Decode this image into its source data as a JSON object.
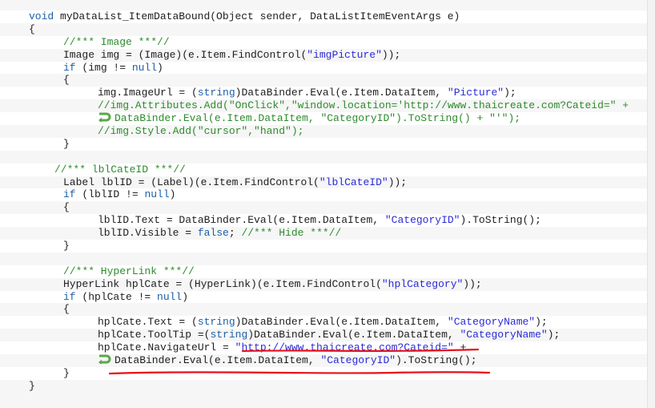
{
  "code_lines": [
    [
      [
        "kw",
        "void"
      ],
      [
        "tx",
        " myDataList_ItemDataBound(Object sender, DataListItemEventArgs e)"
      ]
    ],
    [
      [
        "tx",
        "{"
      ]
    ],
    [
      [
        "cm",
        "//*** Image ***//"
      ]
    ],
    [
      [
        "tx",
        "Image img = (Image)(e.Item.FindControl("
      ],
      [
        "str",
        "\"imgPicture\""
      ],
      [
        "tx",
        "));"
      ]
    ],
    [
      [
        "kw",
        "if"
      ],
      [
        "tx",
        " (img != "
      ],
      [
        "kw",
        "null"
      ],
      [
        "tx",
        ")"
      ]
    ],
    [
      [
        "tx",
        "{"
      ]
    ],
    [
      [
        "tx",
        "img.ImageUrl = ("
      ],
      [
        "kw",
        "string"
      ],
      [
        "tx",
        ")DataBinder.Eval(e.Item.DataItem, "
      ],
      [
        "str",
        "\"Picture\""
      ],
      [
        "tx",
        ");"
      ]
    ],
    [
      [
        "cm",
        "//img.Attributes.Add(\"OnClick\",\"window.location='http://www.thaicreate.com?Cateid=\" +"
      ]
    ],
    [
      [
        "wrap",
        "word-wrap-arrow-icon"
      ],
      [
        "cm",
        "DataBinder.Eval(e.Item.DataItem, \"CategoryID\").ToString() + \"'\");"
      ]
    ],
    [
      [
        "cm",
        "//img.Style.Add(\"cursor\",\"hand\");"
      ]
    ],
    [
      [
        "tx",
        "}"
      ]
    ],
    [],
    [
      [
        "cm",
        "//*** lblCateID ***//"
      ]
    ],
    [
      [
        "tx",
        "Label lblID = (Label)(e.Item.FindControl("
      ],
      [
        "str",
        "\"lblCateID\""
      ],
      [
        "tx",
        "));"
      ]
    ],
    [
      [
        "kw",
        "if"
      ],
      [
        "tx",
        " (lblID != "
      ],
      [
        "kw",
        "null"
      ],
      [
        "tx",
        ")"
      ]
    ],
    [
      [
        "tx",
        "{"
      ]
    ],
    [
      [
        "tx",
        "lblID.Text = DataBinder.Eval(e.Item.DataItem, "
      ],
      [
        "str",
        "\"CategoryID\""
      ],
      [
        "tx",
        ").ToString();"
      ]
    ],
    [
      [
        "tx",
        "lblID.Visible = "
      ],
      [
        "kw",
        "false"
      ],
      [
        "tx",
        "; "
      ],
      [
        "cm",
        "//*** Hide ***//"
      ]
    ],
    [
      [
        "tx",
        "}"
      ]
    ],
    [],
    [
      [
        "cm",
        "//*** HyperLink ***//"
      ]
    ],
    [
      [
        "tx",
        "HyperLink hplCate = (HyperLink)(e.Item.FindControl("
      ],
      [
        "str",
        "\"hplCategory\""
      ],
      [
        "tx",
        "));"
      ]
    ],
    [
      [
        "kw",
        "if"
      ],
      [
        "tx",
        " (hplCate != "
      ],
      [
        "kw",
        "null"
      ],
      [
        "tx",
        ")"
      ]
    ],
    [
      [
        "tx",
        "{"
      ]
    ],
    [
      [
        "tx",
        "hplCate.Text = ("
      ],
      [
        "kw",
        "string"
      ],
      [
        "tx",
        ")DataBinder.Eval(e.Item.DataItem, "
      ],
      [
        "str",
        "\"CategoryName\""
      ],
      [
        "tx",
        ");"
      ]
    ],
    [
      [
        "tx",
        "hplCate.ToolTip =("
      ],
      [
        "kw",
        "string"
      ],
      [
        "tx",
        ")DataBinder.Eval(e.Item.DataItem, "
      ],
      [
        "str",
        "\"CategoryName\""
      ],
      [
        "tx",
        ");"
      ]
    ],
    [
      [
        "tx",
        "hplCate.NavigateUrl = "
      ],
      [
        "str",
        "\"http://www.thaicreate.com?Cateid=\""
      ],
      [
        "tx",
        " +"
      ]
    ],
    [
      [
        "wrap",
        "word-wrap-arrow-icon"
      ],
      [
        "tx",
        "DataBinder.Eval(e.Item.DataItem, "
      ],
      [
        "str",
        "\"CategoryID\""
      ],
      [
        "tx",
        ").ToString();"
      ]
    ],
    [
      [
        "tx",
        "}"
      ]
    ],
    [
      [
        "tx",
        "}"
      ]
    ]
  ],
  "colors": {
    "keyword": "#1d5fa8",
    "string": "#2a2ad8",
    "comment": "#2e8b2e",
    "annotation": "#e8101a"
  }
}
